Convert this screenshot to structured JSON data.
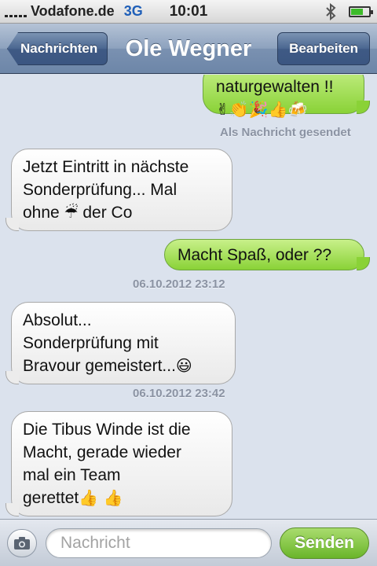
{
  "status": {
    "carrier": "Vodafone.de",
    "network": "3G",
    "time": "10:01",
    "battery_level": 0.7
  },
  "nav": {
    "back_label": "Nachrichten",
    "title": "Ole Wegner",
    "edit_label": "Bearbeiten"
  },
  "messages": [
    {
      "direction": "out",
      "text": "naturgewalten !!",
      "emojis": "✌👏🎉👍🍻"
    },
    {
      "direction": "in",
      "lines": [
        "Jetzt Eintritt in nächste",
        "Sonderprüfung... Mal"
      ],
      "line3_pre": "ohne",
      "line3_emoji": "☔",
      "line3_post": "der Co"
    },
    {
      "direction": "out",
      "text": "Macht Spaß, oder ??"
    },
    {
      "direction": "in",
      "lines": [
        "Absolut...",
        "Sonderprüfung mit"
      ],
      "line3_pre": "Bravour gemeistert...",
      "line3_emoji": "😃"
    },
    {
      "direction": "in",
      "lines": [
        "Die Tibus Winde ist die",
        "Macht, gerade wieder",
        "mal ein Team"
      ],
      "line4_pre": "gerettet",
      "line4_emoji": "👍 👍"
    }
  ],
  "delivery_status": "Als Nachricht gesendet",
  "timestamps": [
    "06.10.2012 23:12",
    "06.10.2012 23:42"
  ],
  "input": {
    "placeholder": "Nachricht",
    "send_label": "Senden"
  },
  "colors": {
    "outgoing_bubble": "#8ad237",
    "incoming_bubble": "#ffffff",
    "navbar": "#7a91b1",
    "background": "#dbe2ed"
  }
}
